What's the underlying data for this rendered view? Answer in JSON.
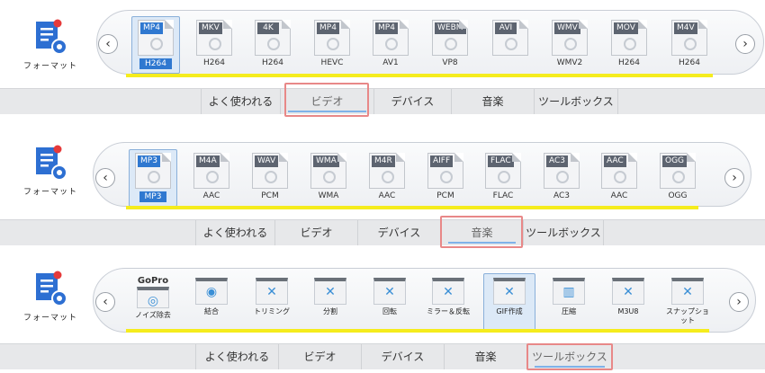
{
  "panels": [
    {
      "logo_label": "フォーマット",
      "prev": "‹",
      "next": "›",
      "items": [
        {
          "tag": "MP4",
          "sub": "H264",
          "selected": true
        },
        {
          "tag": "MKV",
          "sub": "H264"
        },
        {
          "tag": "4K",
          "sub": "H264"
        },
        {
          "tag": "MP4",
          "sub": "HEVC"
        },
        {
          "tag": "MP4",
          "sub": "AV1"
        },
        {
          "tag": "WEBM",
          "sub": "VP8"
        },
        {
          "tag": "AVI",
          "sub": ""
        },
        {
          "tag": "WMV",
          "sub": "WMV2"
        },
        {
          "tag": "MOV",
          "sub": "H264"
        },
        {
          "tag": "M4V",
          "sub": "H264"
        }
      ],
      "tabs": [
        "よく使われる",
        "ビデオ",
        "デバイス",
        "音楽",
        "ツールボックス"
      ],
      "active_tab": 1
    },
    {
      "logo_label": "フォーマット",
      "prev": "‹",
      "next": "›",
      "items": [
        {
          "tag": "MP3",
          "sub": "MP3",
          "selected": true
        },
        {
          "tag": "M4A",
          "sub": "AAC"
        },
        {
          "tag": "WAV",
          "sub": "PCM"
        },
        {
          "tag": "WMA",
          "sub": "WMA"
        },
        {
          "tag": "M4R",
          "sub": "AAC"
        },
        {
          "tag": "AIFF",
          "sub": "PCM"
        },
        {
          "tag": "FLAC",
          "sub": "FLAC"
        },
        {
          "tag": "AC3",
          "sub": "AC3"
        },
        {
          "tag": "AAC",
          "sub": "AAC"
        },
        {
          "tag": "OGG",
          "sub": "OGG"
        }
      ],
      "tabs": [
        "よく使われる",
        "ビデオ",
        "デバイス",
        "音楽",
        "ツールボックス"
      ],
      "active_tab": 3
    },
    {
      "logo_label": "フォーマット",
      "prev": "‹",
      "next": "›",
      "gopro_label": "GoPro",
      "tools": [
        {
          "label": "ノイズ除去",
          "icon": "denoise-icon",
          "glyph": "◎"
        },
        {
          "label": "結合",
          "icon": "merge-icon",
          "glyph": "◉"
        },
        {
          "label": "トリミング",
          "icon": "trim-icon",
          "glyph": "✕"
        },
        {
          "label": "分割",
          "icon": "split-icon",
          "glyph": "✕"
        },
        {
          "label": "回転",
          "icon": "rotate-icon",
          "glyph": "✕"
        },
        {
          "label": "ミラー＆反転",
          "icon": "mirror-icon",
          "glyph": "✕"
        },
        {
          "label": "GIF作成",
          "icon": "gif-icon",
          "glyph": "✕",
          "selected": true
        },
        {
          "label": "圧縮",
          "icon": "compress-icon",
          "glyph": "▥"
        },
        {
          "label": "M3U8",
          "icon": "m3u8-icon",
          "glyph": "✕"
        },
        {
          "label": "スナップショット",
          "icon": "snapshot-icon",
          "glyph": "✕"
        }
      ],
      "tabs": [
        "よく使われる",
        "ビデオ",
        "デバイス",
        "音楽",
        "ツールボックス"
      ],
      "active_tab": 4
    }
  ]
}
